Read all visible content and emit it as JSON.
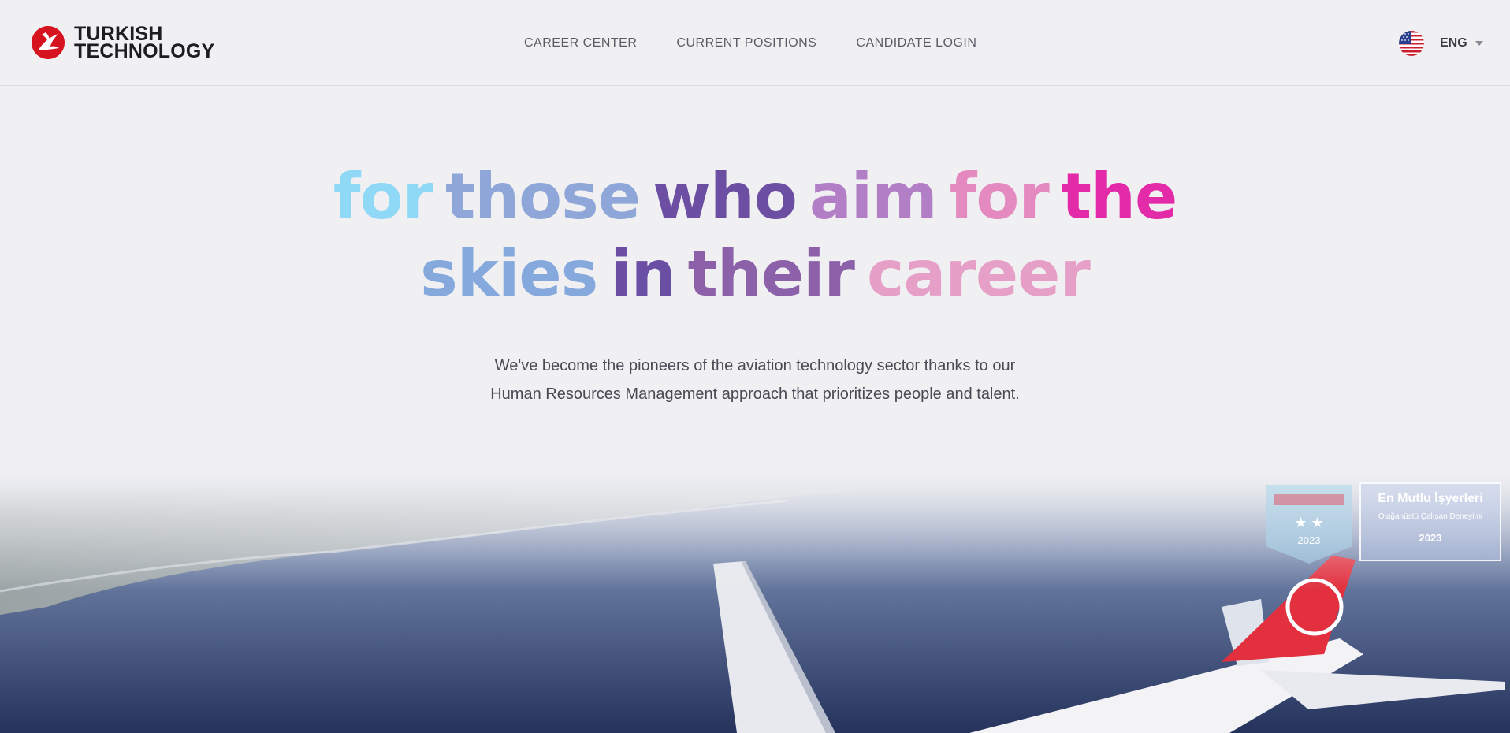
{
  "brand": {
    "line1": "TURKISH",
    "line2": "TECHNOLOGY"
  },
  "nav": [
    {
      "label": "CAREER CENTER"
    },
    {
      "label": "CURRENT POSITIONS"
    },
    {
      "label": "CANDIDATE LOGIN"
    }
  ],
  "language": {
    "label": "ENG",
    "icon": "us-flag-icon"
  },
  "hero": {
    "line1": [
      "for",
      "those",
      "who",
      "aim",
      "for",
      "the"
    ],
    "line2": [
      "skies",
      "in",
      "their",
      "career"
    ],
    "subtitle_line1": "We've become the pioneers of the aviation technology sector thanks to our",
    "subtitle_line2": "Human Resources Management approach that prioritizes people and talent."
  },
  "badges": {
    "a": {
      "stars": "★ ★",
      "year": "2023"
    },
    "b": {
      "title": "En Mutlu İşyerleri",
      "subtitle": "Olağanüstü Çalışan Deneyimi",
      "year": "2023"
    }
  },
  "colors": {
    "line1": [
      "#8fd8f6",
      "#8fa7d8",
      "#6c4ea3",
      "#b27fc6",
      "#e48ac0",
      "#e32aa8"
    ],
    "line2": [
      "#86a9dd",
      "#6a4fa5",
      "#8d61a9",
      "#e6a0c8",
      "#e251ae"
    ]
  }
}
